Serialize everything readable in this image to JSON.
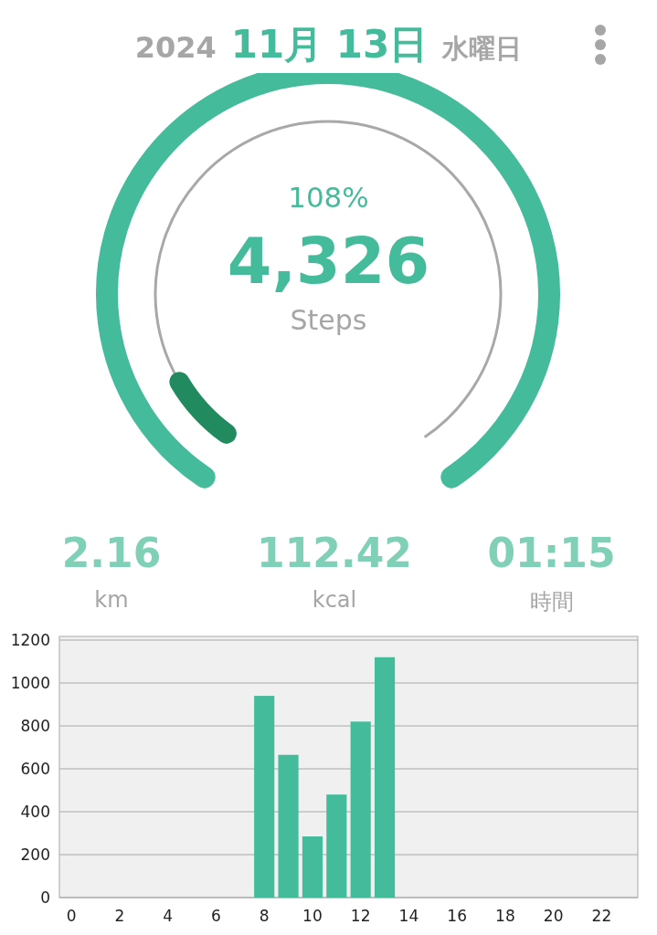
{
  "header": {
    "year": "2024",
    "date": "11月 13日",
    "weekday": "水曜日"
  },
  "gauge": {
    "percent": "108%",
    "steps": "4,326",
    "unit": "Steps",
    "rings": [
      {
        "kind": "goal",
        "level": 1
      },
      {
        "kind": "overflow",
        "level": 0.08
      }
    ]
  },
  "stats": [
    {
      "value": "2.16",
      "label": "km"
    },
    {
      "value": "112.42",
      "label": "kcal"
    },
    {
      "value": "01:15",
      "label": "時間"
    }
  ],
  "chart_data": {
    "type": "bar",
    "x": [
      8,
      9,
      10,
      11,
      12,
      13
    ],
    "xlim": [
      -0.5,
      23.5
    ],
    "grid": true,
    "series": [
      {
        "color": "#44bb9a",
        "values": [
          940,
          665,
          285,
          480,
          820,
          1120
        ]
      }
    ],
    "ylim": [
      0,
      1200
    ],
    "yticks": [
      0,
      200,
      400,
      600,
      800,
      1000,
      1200
    ],
    "xticks": [
      0,
      2,
      4,
      6,
      8,
      10,
      12,
      14,
      16,
      18,
      20,
      22
    ]
  }
}
